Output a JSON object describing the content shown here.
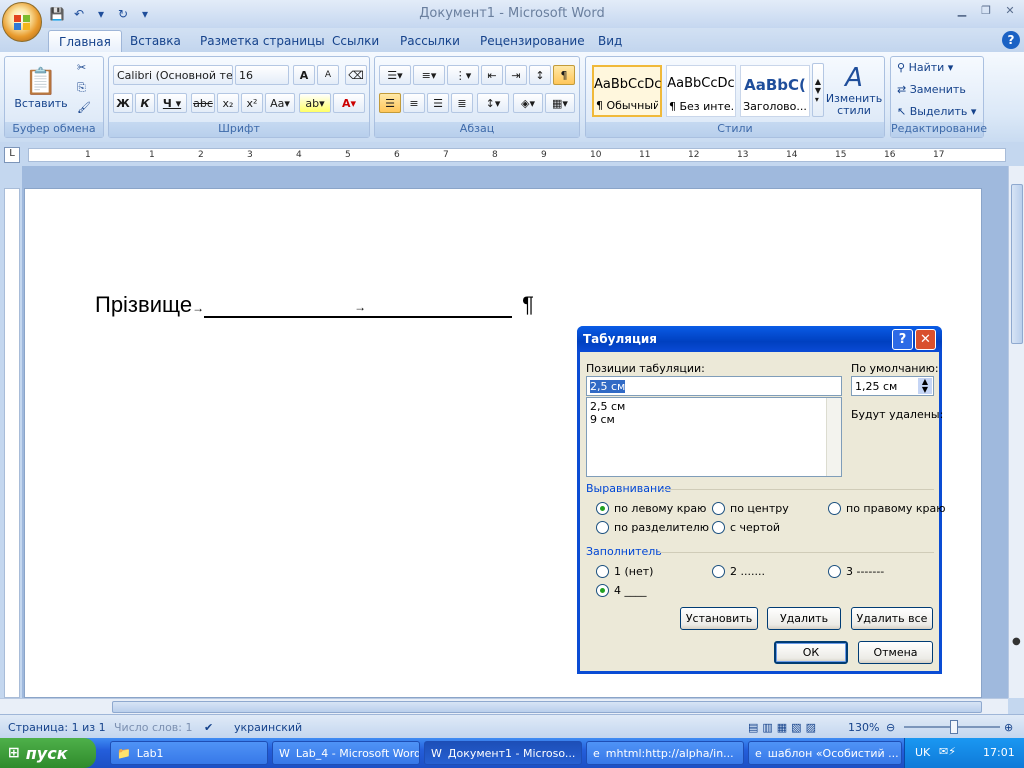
{
  "window": {
    "title": "Документ1 - Microsoft Word"
  },
  "tabs": [
    "Главная",
    "Вставка",
    "Разметка страницы",
    "Ссылки",
    "Рассылки",
    "Рецензирование",
    "Вид"
  ],
  "ribbon": {
    "clipboard": {
      "label": "Буфер обмена",
      "paste": "Вставить"
    },
    "font": {
      "label": "Шрифт",
      "name": "Calibri (Основной те",
      "size": "16"
    },
    "paragraph": {
      "label": "Абзац"
    },
    "styles": {
      "label": "Стили",
      "items": [
        {
          "preview": "AaBbCcDc",
          "caption": "¶ Обычный"
        },
        {
          "preview": "AaBbCcDc",
          "caption": "¶ Без инте..."
        },
        {
          "preview": "AaBbC(",
          "caption": "Заголово..."
        }
      ],
      "change": "Изменить стили"
    },
    "editing": {
      "label": "Редактирование",
      "find": "Найти",
      "replace": "Заменить",
      "select": "Выделить"
    }
  },
  "ruler": {
    "numbers": [
      "1",
      "1",
      "2",
      "3",
      "4",
      "5",
      "6",
      "7",
      "8",
      "9",
      "10",
      "11",
      "12",
      "13",
      "14",
      "15",
      "16",
      "17"
    ]
  },
  "document": {
    "text": "Прізвище"
  },
  "dialog": {
    "title": "Табуляция",
    "positions_label": "Позиции табуляции:",
    "position_value": "2,5 см",
    "positions": [
      "2,5 см",
      "9 см"
    ],
    "default_label": "По умолчанию:",
    "default_value": "1,25 см",
    "to_delete_label": "Будут удалены:",
    "alignment_label": "Выравнивание",
    "alignment": [
      {
        "label": "по левому краю",
        "selected": true
      },
      {
        "label": "по центру",
        "selected": false
      },
      {
        "label": "по правому краю",
        "selected": false
      },
      {
        "label": "по разделителю",
        "selected": false
      },
      {
        "label": "с чертой",
        "selected": false
      }
    ],
    "leader_label": "Заполнитель",
    "leaders": [
      {
        "label": "1 (нет)",
        "selected": false
      },
      {
        "label": "2 .......",
        "selected": false
      },
      {
        "label": "3 -------",
        "selected": false
      },
      {
        "label": "4 ____",
        "selected": true
      }
    ],
    "btn_set": "Установить",
    "btn_delete": "Удалить",
    "btn_delete_all": "Удалить все",
    "btn_ok": "ОК",
    "btn_cancel": "Отмена"
  },
  "status": {
    "page": "Страница: 1 из 1",
    "words": "Число слов: 1",
    "lang": "украинский",
    "zoom": "130%"
  },
  "taskbar": {
    "start": "пуск",
    "items": [
      "Lab1",
      "Lab_4 - Microsoft Word",
      "Документ1 - Microso...",
      "mhtml:http://alpha/in...",
      "шаблон «Особистий ..."
    ],
    "lang": "UK",
    "time": "17:01"
  },
  "colors": {
    "accent": "#15428b",
    "dialog_title": "#0a4cd4",
    "taskbar": "#245edb"
  }
}
